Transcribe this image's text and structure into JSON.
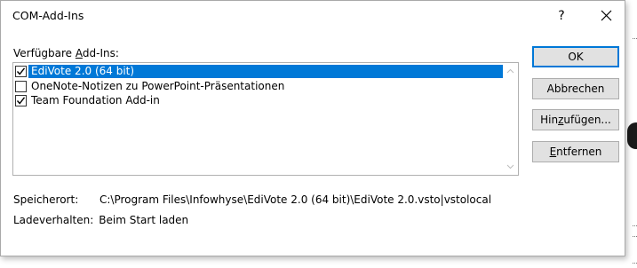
{
  "dialog": {
    "title": "COM-Add-Ins",
    "help_label": "?",
    "close_label": "close"
  },
  "list": {
    "label_pre": "Verfügbare ",
    "label_accel": "A",
    "label_post": "dd-Ins:",
    "items": [
      {
        "label": "EdiVote 2.0 (64 bit)",
        "checked": true,
        "selected": true
      },
      {
        "label": "OneNote-Notizen zu PowerPoint-Präsentationen",
        "checked": false,
        "selected": false
      },
      {
        "label": "Team Foundation Add-in",
        "checked": true,
        "selected": false
      }
    ]
  },
  "buttons": {
    "ok": "OK",
    "cancel": "Abbrechen",
    "add_pre": "Hin",
    "add_accel": "z",
    "add_post": "ufügen...",
    "remove_pre": "",
    "remove_accel": "E",
    "remove_post": "ntfernen"
  },
  "details": {
    "location_label": "Speicherort:",
    "location_value": "C:\\Program Files\\Infowhyse\\EdiVote 2.0 (64 bit)\\EdiVote 2.0.vsto|vstolocal",
    "load_label": "Ladeverhalten:",
    "load_value": "Beim Start laden"
  },
  "colors": {
    "selection": "#0078d7",
    "button_face": "#e1e1e1"
  }
}
